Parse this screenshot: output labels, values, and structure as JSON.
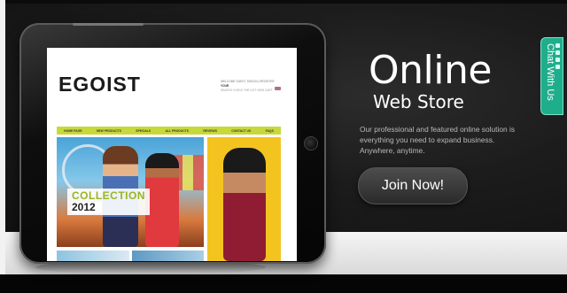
{
  "store": {
    "logo": "EGOIST",
    "header_line1": "WELCOME GUEST, SIGN IN | REGISTER",
    "header_line2": "YOUR",
    "header_line3": "SEARCH   CHECK THE LIST   VIEW CART",
    "nav": [
      "HOME PAGE",
      "NEW PRODUCTS",
      "SPECIALS",
      "ALL PRODUCTS",
      "REVIEWS",
      "CONTACT US",
      "FAQS"
    ],
    "collection_label": "COLLECTION",
    "collection_year": "2012"
  },
  "promo": {
    "title": "Online",
    "subtitle": "Web Store",
    "description": "Our professional and featured online solution is everything you need to expand business. Anywhere, anytime.",
    "button": "Join Now!"
  },
  "chat": {
    "label": "Chat With Us"
  },
  "colors": {
    "accent_green": "#c7d93a",
    "chat_teal": "#1fae8c"
  }
}
